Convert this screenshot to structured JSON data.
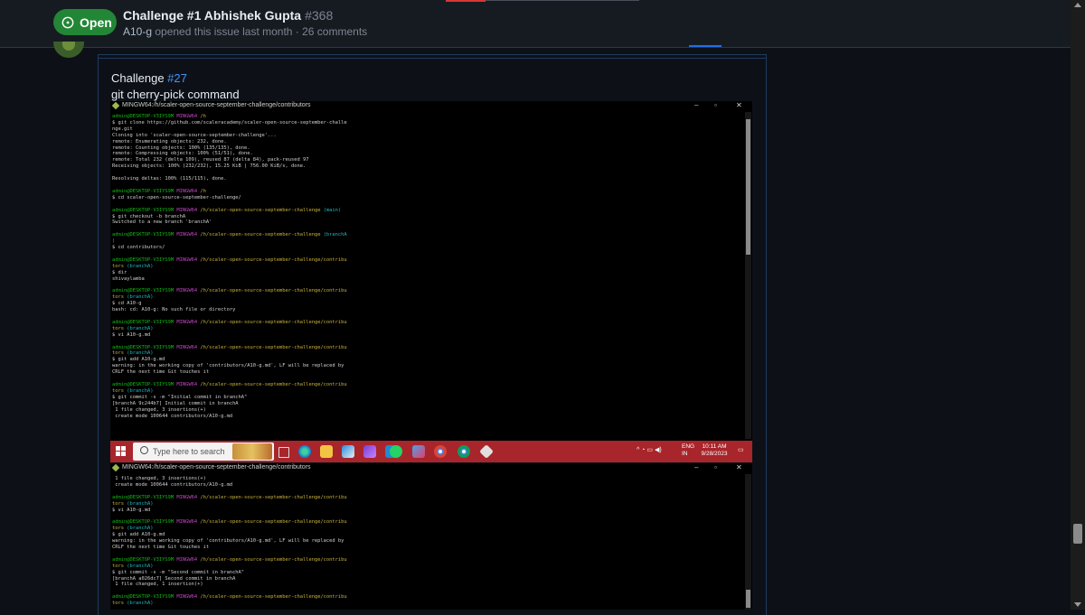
{
  "header": {
    "status_label": "Open",
    "title": "Challenge #1 Abhishek Gupta",
    "number": "#368",
    "author": "A10-g",
    "meta_rest": " opened this issue last month · 26 comments"
  },
  "comment": {
    "heading_text": "Challenge ",
    "heading_link": "#27",
    "subheading": "git cherry-pick command"
  },
  "terminal1": {
    "title": "MINGW64:/h/scaler-open-source-september-challenge/contributors",
    "lines": [
      [
        {
          "t": "admin@DESKTOP-V3IYS9M ",
          "c": "g"
        },
        {
          "t": "MINGW64 ",
          "c": "m"
        },
        {
          "t": "/h",
          "c": "y"
        }
      ],
      [
        {
          "t": "$ git clone https://github.com/scaleracademy/scaler-open-source-september-challe"
        }
      ],
      [
        {
          "t": "nge.git"
        }
      ],
      [
        {
          "t": "Cloning into 'scaler-open-source-september-challenge'..."
        }
      ],
      [
        {
          "t": "remote: Enumerating objects: 232, done."
        }
      ],
      [
        {
          "t": "remote: Counting objects: 100% (135/135), done."
        }
      ],
      [
        {
          "t": "remote: Compressing objects: 100% (51/51), done."
        }
      ],
      [
        {
          "t": "remote: Total 232 (delta 109), reused 87 (delta 84), pack-reused 97"
        }
      ],
      [
        {
          "t": "Receiving objects: 100% (232/232), 15.25 KiB | 756.00 KiB/s, done."
        }
      ],
      [
        {
          "t": ""
        }
      ],
      [
        {
          "t": "Resolving deltas: 100% (115/115), done."
        }
      ],
      [
        {
          "t": ""
        }
      ],
      [
        {
          "t": "admin@DESKTOP-V3IYS9M ",
          "c": "g"
        },
        {
          "t": "MINGW64 ",
          "c": "m"
        },
        {
          "t": "/h",
          "c": "y"
        }
      ],
      [
        {
          "t": "$ cd scaler-open-source-september-challenge/"
        }
      ],
      [
        {
          "t": ""
        }
      ],
      [
        {
          "t": "admin@DESKTOP-V3IYS9M ",
          "c": "g"
        },
        {
          "t": "MINGW64 ",
          "c": "m"
        },
        {
          "t": "/h/scaler-open-source-september-challenge ",
          "c": "y"
        },
        {
          "t": "(main)",
          "c": "c"
        }
      ],
      [
        {
          "t": "$ git checkout -b branchA"
        }
      ],
      [
        {
          "t": "Switched to a new branch 'branchA'"
        }
      ],
      [
        {
          "t": ""
        }
      ],
      [
        {
          "t": "admin@DESKTOP-V3IYS9M ",
          "c": "g"
        },
        {
          "t": "MINGW64 ",
          "c": "m"
        },
        {
          "t": "/h/scaler-open-source-september-challenge ",
          "c": "y"
        },
        {
          "t": "(branchA",
          "c": "c"
        }
      ],
      [
        {
          "t": ")",
          "c": "c"
        }
      ],
      [
        {
          "t": "$ cd contributors/"
        }
      ],
      [
        {
          "t": ""
        }
      ],
      [
        {
          "t": "admin@DESKTOP-V3IYS9M ",
          "c": "g"
        },
        {
          "t": "MINGW64 ",
          "c": "m"
        },
        {
          "t": "/h/scaler-open-source-september-challenge/contribu",
          "c": "y"
        }
      ],
      [
        {
          "t": "tors ",
          "c": "y"
        },
        {
          "t": "(branchA)",
          "c": "c"
        }
      ],
      [
        {
          "t": "$ dir"
        }
      ],
      [
        {
          "t": "shivaylamba"
        }
      ],
      [
        {
          "t": ""
        }
      ],
      [
        {
          "t": "admin@DESKTOP-V3IYS9M ",
          "c": "g"
        },
        {
          "t": "MINGW64 ",
          "c": "m"
        },
        {
          "t": "/h/scaler-open-source-september-challenge/contribu",
          "c": "y"
        }
      ],
      [
        {
          "t": "tors ",
          "c": "y"
        },
        {
          "t": "(branchA)",
          "c": "c"
        }
      ],
      [
        {
          "t": "$ cd A10-g"
        }
      ],
      [
        {
          "t": "bash: cd: A10-g: No such file or directory"
        }
      ],
      [
        {
          "t": ""
        }
      ],
      [
        {
          "t": "admin@DESKTOP-V3IYS9M ",
          "c": "g"
        },
        {
          "t": "MINGW64 ",
          "c": "m"
        },
        {
          "t": "/h/scaler-open-source-september-challenge/contribu",
          "c": "y"
        }
      ],
      [
        {
          "t": "tors ",
          "c": "y"
        },
        {
          "t": "(branchA)",
          "c": "c"
        }
      ],
      [
        {
          "t": "$ vi A10-g.md"
        }
      ],
      [
        {
          "t": ""
        }
      ],
      [
        {
          "t": "admin@DESKTOP-V3IYS9M ",
          "c": "g"
        },
        {
          "t": "MINGW64 ",
          "c": "m"
        },
        {
          "t": "/h/scaler-open-source-september-challenge/contribu",
          "c": "y"
        }
      ],
      [
        {
          "t": "tors ",
          "c": "y"
        },
        {
          "t": "(branchA)",
          "c": "c"
        }
      ],
      [
        {
          "t": "$ git add A10-g.md"
        }
      ],
      [
        {
          "t": "warning: in the working copy of 'contributors/A10-g.md', LF will be replaced by"
        }
      ],
      [
        {
          "t": "CRLF the next time Git touches it"
        }
      ],
      [
        {
          "t": ""
        }
      ],
      [
        {
          "t": "admin@DESKTOP-V3IYS9M ",
          "c": "g"
        },
        {
          "t": "MINGW64 ",
          "c": "m"
        },
        {
          "t": "/h/scaler-open-source-september-challenge/contribu",
          "c": "y"
        }
      ],
      [
        {
          "t": "tors ",
          "c": "y"
        },
        {
          "t": "(branchA)",
          "c": "c"
        }
      ],
      [
        {
          "t": "$ git commit -s -m \"Initial commit in branchA\""
        }
      ],
      [
        {
          "t": "[branchA 9c244b7] Initial commit in branchA"
        }
      ],
      [
        {
          "t": " 1 file changed, 3 insertions(+)"
        }
      ],
      [
        {
          "t": " create mode 100644 contributors/A10-g.md"
        }
      ]
    ]
  },
  "taskbar": {
    "search_placeholder": "Type here to search",
    "lang_top": "ENG",
    "lang_bottom": "IN",
    "time": "10:11 AM",
    "date": "9/28/2023"
  },
  "terminal2": {
    "title": "MINGW64:/h/scaler-open-source-september-challenge/contributors",
    "lines": [
      [
        {
          "t": " 1 file changed, 3 insertions(+)"
        }
      ],
      [
        {
          "t": " create mode 100644 contributors/A10-g.md"
        }
      ],
      [
        {
          "t": ""
        }
      ],
      [
        {
          "t": "admin@DESKTOP-V3IYS9M ",
          "c": "g"
        },
        {
          "t": "MINGW64 ",
          "c": "m"
        },
        {
          "t": "/h/scaler-open-source-september-challenge/contribu",
          "c": "y"
        }
      ],
      [
        {
          "t": "tors ",
          "c": "y"
        },
        {
          "t": "(branchA)",
          "c": "c"
        }
      ],
      [
        {
          "t": "$ vi A10-g.md"
        }
      ],
      [
        {
          "t": ""
        }
      ],
      [
        {
          "t": "admin@DESKTOP-V3IYS9M ",
          "c": "g"
        },
        {
          "t": "MINGW64 ",
          "c": "m"
        },
        {
          "t": "/h/scaler-open-source-september-challenge/contribu",
          "c": "y"
        }
      ],
      [
        {
          "t": "tors ",
          "c": "y"
        },
        {
          "t": "(branchA)",
          "c": "c"
        }
      ],
      [
        {
          "t": "$ git add A10-g.md"
        }
      ],
      [
        {
          "t": "warning: in the working copy of 'contributors/A10-g.md', LF will be replaced by"
        }
      ],
      [
        {
          "t": "CRLF the next time Git touches it"
        }
      ],
      [
        {
          "t": ""
        }
      ],
      [
        {
          "t": "admin@DESKTOP-V3IYS9M ",
          "c": "g"
        },
        {
          "t": "MINGW64 ",
          "c": "m"
        },
        {
          "t": "/h/scaler-open-source-september-challenge/contribu",
          "c": "y"
        }
      ],
      [
        {
          "t": "tors ",
          "c": "y"
        },
        {
          "t": "(branchA)",
          "c": "c"
        }
      ],
      [
        {
          "t": "$ git commit -s -m \"Second commit in branchA\""
        }
      ],
      [
        {
          "t": "[branchA a026dc7] Second commit in branchA"
        }
      ],
      [
        {
          "t": " 1 file changed, 1 insertion(+)"
        }
      ],
      [
        {
          "t": ""
        }
      ],
      [
        {
          "t": "admin@DESKTOP-V3IYS9M ",
          "c": "g"
        },
        {
          "t": "MINGW64 ",
          "c": "m"
        },
        {
          "t": "/h/scaler-open-source-september-challenge/contribu",
          "c": "y"
        }
      ],
      [
        {
          "t": "tors ",
          "c": "y"
        },
        {
          "t": "(branchA)",
          "c": "c"
        }
      ]
    ]
  },
  "colors": {
    "open_badge": "#238636",
    "link": "#4493f8",
    "taskbar": "#a8252b",
    "prompt_user": "#12b912",
    "prompt_shell": "#c845c8",
    "prompt_path": "#c9b23a",
    "prompt_branch": "#1fb8c0"
  },
  "icons": {
    "status": "issue-open-icon",
    "terminal": "git-bash-icon",
    "taskbar_apps": [
      "task-view-icon",
      "edge-icon",
      "file-explorer-icon",
      "store-icon",
      "visual-studio-icon",
      "vscode-icon",
      "whatsapp-icon",
      "snipping-tool-icon",
      "chrome-icon",
      "chrome-icon",
      "git-bash-icon"
    ]
  }
}
